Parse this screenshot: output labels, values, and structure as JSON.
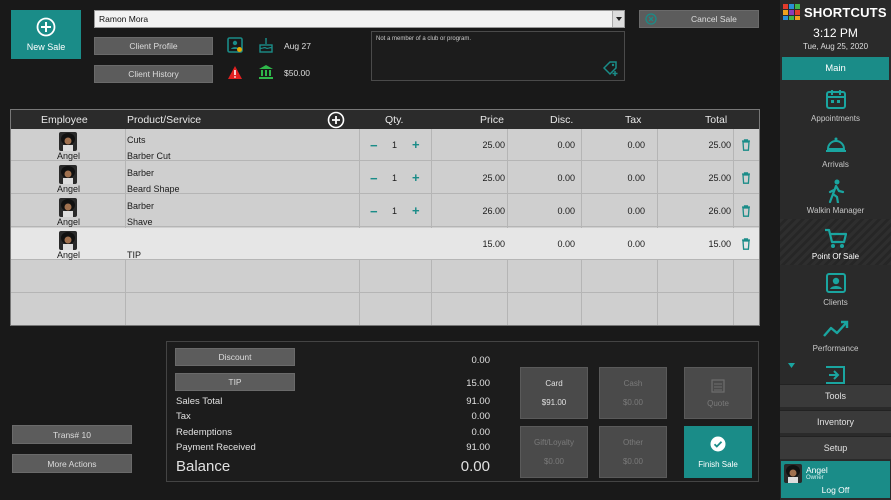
{
  "header": {
    "new_sale_label": "New Sale",
    "client_name": "Ramon Mora",
    "cancel_sale_label": "Cancel Sale",
    "client_profile_label": "Client Profile",
    "client_history_label": "Client History",
    "birthday": "Aug 27",
    "balance_due": "$50.00",
    "membership_note": "Not a member of a club or program."
  },
  "table": {
    "columns": [
      "Employee",
      "Product/Service",
      "Qty.",
      "Price",
      "Disc.",
      "Tax",
      "Total"
    ],
    "rows": [
      {
        "employee": "Angel",
        "category": "Cuts",
        "item": "Barber Cut",
        "qty": "1",
        "price": "25.00",
        "disc": "0.00",
        "tax": "0.00",
        "total": "25.00"
      },
      {
        "employee": "Angel",
        "category": "Barber",
        "item": "Beard Shape",
        "qty": "1",
        "price": "25.00",
        "disc": "0.00",
        "tax": "0.00",
        "total": "25.00"
      },
      {
        "employee": "Angel",
        "category": "Barber",
        "item": "Shave",
        "qty": "1",
        "price": "26.00",
        "disc": "0.00",
        "tax": "0.00",
        "total": "26.00"
      },
      {
        "employee": "Angel",
        "category": "",
        "item": "TIP",
        "qty": "",
        "price": "15.00",
        "disc": "0.00",
        "tax": "0.00",
        "total": "15.00"
      }
    ]
  },
  "left_actions": {
    "trans_label": "Trans# 10",
    "more_actions_label": "More Actions"
  },
  "totals": {
    "discount_label": "Discount",
    "discount_value": "0.00",
    "tip_label": "TIP",
    "tip_value": "15.00",
    "sales_total_label": "Sales Total",
    "sales_total_value": "91.00",
    "tax_label": "Tax",
    "tax_value": "0.00",
    "redemptions_label": "Redemptions",
    "redemptions_value": "0.00",
    "payment_received_label": "Payment Received",
    "payment_received_value": "91.00",
    "balance_label": "Balance",
    "balance_value": "0.00"
  },
  "payments": {
    "card_label": "Card",
    "card_amount": "$91.00",
    "cash_label": "Cash",
    "cash_amount": "$0.00",
    "quote_label": "Quote",
    "gift_label": "Gift/Loyalty",
    "gift_amount": "$0.00",
    "other_label": "Other",
    "other_amount": "$0.00",
    "finish_label": "Finish Sale"
  },
  "nav": {
    "brand": "SHORTCUTS",
    "time": "3:12 PM",
    "date": "Tue, Aug 25, 2020",
    "main_label": "Main",
    "items": [
      {
        "label": "Appointments",
        "icon": "calendar-icon"
      },
      {
        "label": "Arrivals",
        "icon": "bell-icon"
      },
      {
        "label": "Walkin Manager",
        "icon": "walking-icon"
      },
      {
        "label": "Point Of Sale",
        "icon": "cart-icon"
      },
      {
        "label": "Clients",
        "icon": "client-icon"
      },
      {
        "label": "Performance",
        "icon": "trend-icon"
      }
    ],
    "tools_label": "Tools",
    "inventory_label": "Inventory",
    "setup_label": "Setup",
    "user_name": "Angel",
    "user_role": "Owner",
    "logoff_label": "Log Off"
  },
  "colors": {
    "accent": "#1a8c88",
    "background": "#191919",
    "warning": "#e02020"
  }
}
